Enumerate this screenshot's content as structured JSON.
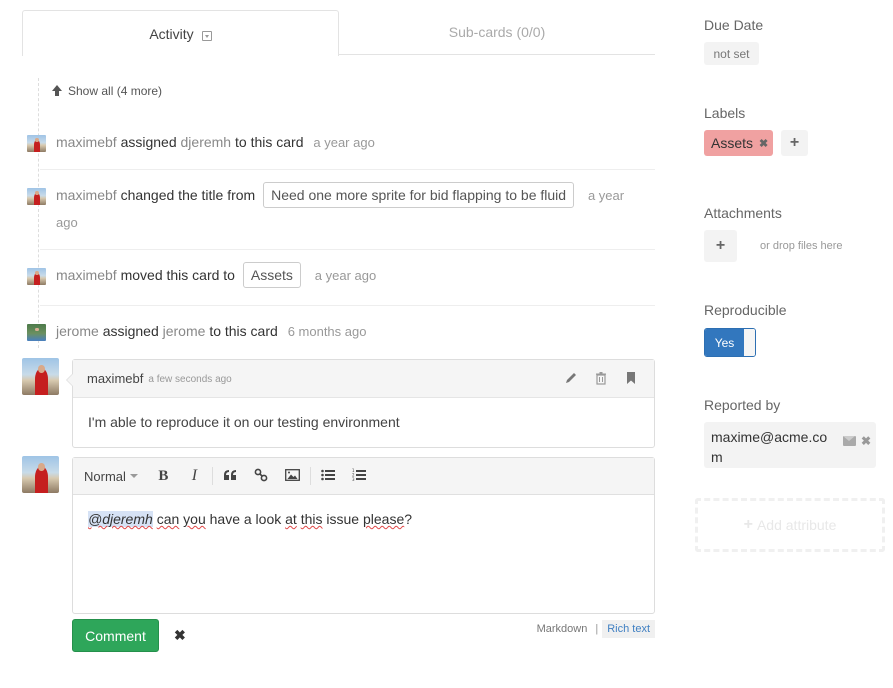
{
  "tabs": [
    {
      "label": "Activity",
      "active": true,
      "icon": "collapse-icon"
    },
    {
      "label": "Sub-cards (0/0)",
      "active": false
    }
  ],
  "timeline": {
    "show_all": "Show all (4 more)",
    "events": [
      {
        "user": "maximebf",
        "verb": "assigned",
        "target_user": "djeremh",
        "suffix": "to this card",
        "ago": "a year ago"
      },
      {
        "user": "maximebf",
        "verb": "changed the title from",
        "chip": "Need one more sprite for bid flapping to be fluid",
        "ago_line1": "a year",
        "ago_line2": "ago"
      },
      {
        "user": "maximebf",
        "verb": "moved this card to",
        "chip": "Assets",
        "ago": "a year ago"
      },
      {
        "user": "jerome",
        "verb": "assigned",
        "target_user": "jerome",
        "suffix": "to this card",
        "ago": "6 months ago"
      }
    ]
  },
  "comment": {
    "author": "maximebf",
    "ago": "a few seconds ago",
    "body": "I'm able to reproduce it on our testing environment",
    "actions": [
      "pencil-icon",
      "trash-icon",
      "bookmark-icon"
    ]
  },
  "editor": {
    "format_select": "Normal",
    "toolbar": [
      "bold",
      "italic",
      "blockquote",
      "link",
      "image",
      "bullet-list",
      "ordered-list"
    ],
    "bold_glyph": "B",
    "italic_glyph": "I",
    "quote_glyph": "❝",
    "link_glyph": "🔗",
    "mention": "@djeremh",
    "words": [
      "can",
      "you",
      "have a look",
      "at",
      "this",
      "issue",
      "please",
      "?"
    ],
    "submit_label": "Comment",
    "cancel_glyph": "✖",
    "mode_markdown": "Markdown",
    "mode_separator": "|",
    "mode_richtext": "Rich text"
  },
  "sidebar": {
    "due_date": {
      "label": "Due Date",
      "value": "not set"
    },
    "labels": {
      "label": "Labels",
      "items": [
        {
          "name": "Assets",
          "color": "#f0a1a1"
        }
      ],
      "add_glyph": "+",
      "remove_glyph": "✖"
    },
    "attachments": {
      "label": "Attachments",
      "add_glyph": "+",
      "hint": "or drop files here"
    },
    "reproducible": {
      "label": "Reproducible",
      "value": "Yes",
      "enabled": true
    },
    "reported_by": {
      "label": "Reported by",
      "email": "maxime@acme.com"
    },
    "add_attribute": {
      "glyph": "+",
      "label": "Add attribute"
    }
  },
  "colors": {
    "primary": "#3277be",
    "success": "#2ea65a",
    "label_assets": "#f0a1a1"
  }
}
